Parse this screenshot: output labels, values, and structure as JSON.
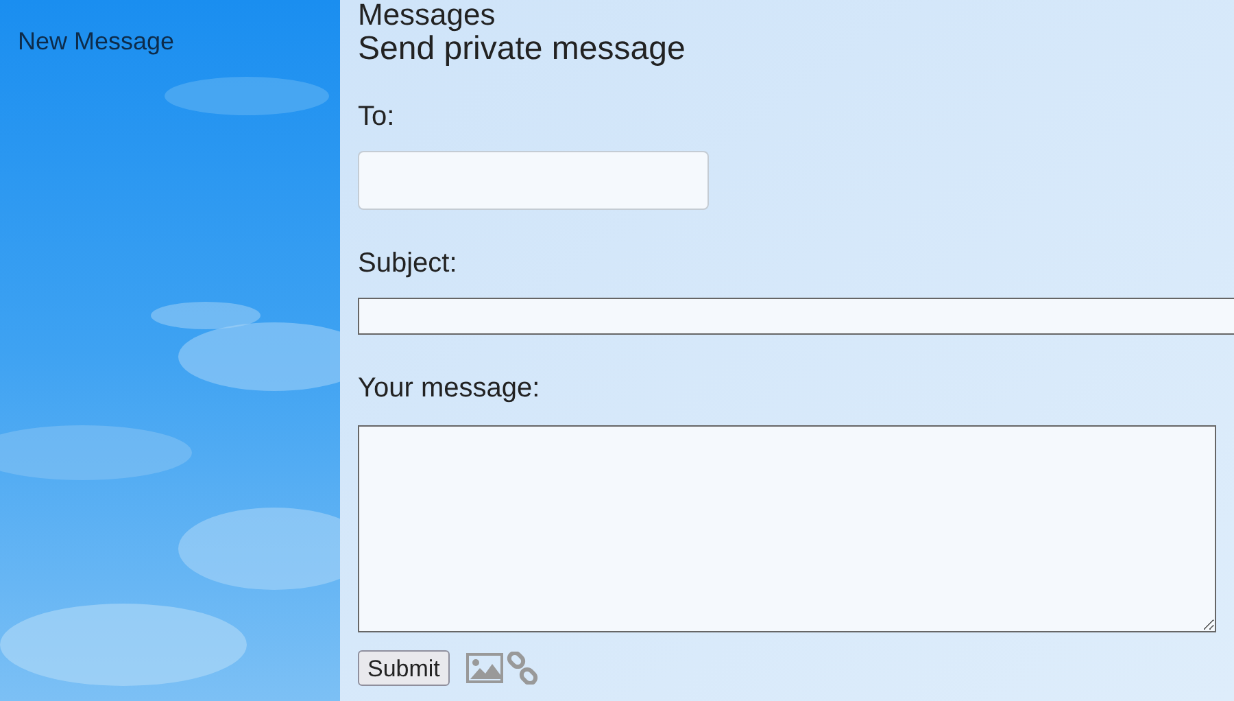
{
  "sidebar": {
    "items": [
      {
        "label": "New Message"
      }
    ]
  },
  "page": {
    "section": "Messages",
    "title": "Send private message"
  },
  "form": {
    "to": {
      "label": "To:"
    },
    "subject": {
      "label": "Subject:"
    },
    "message": {
      "label": "Your message:"
    },
    "submit": "Submit"
  }
}
